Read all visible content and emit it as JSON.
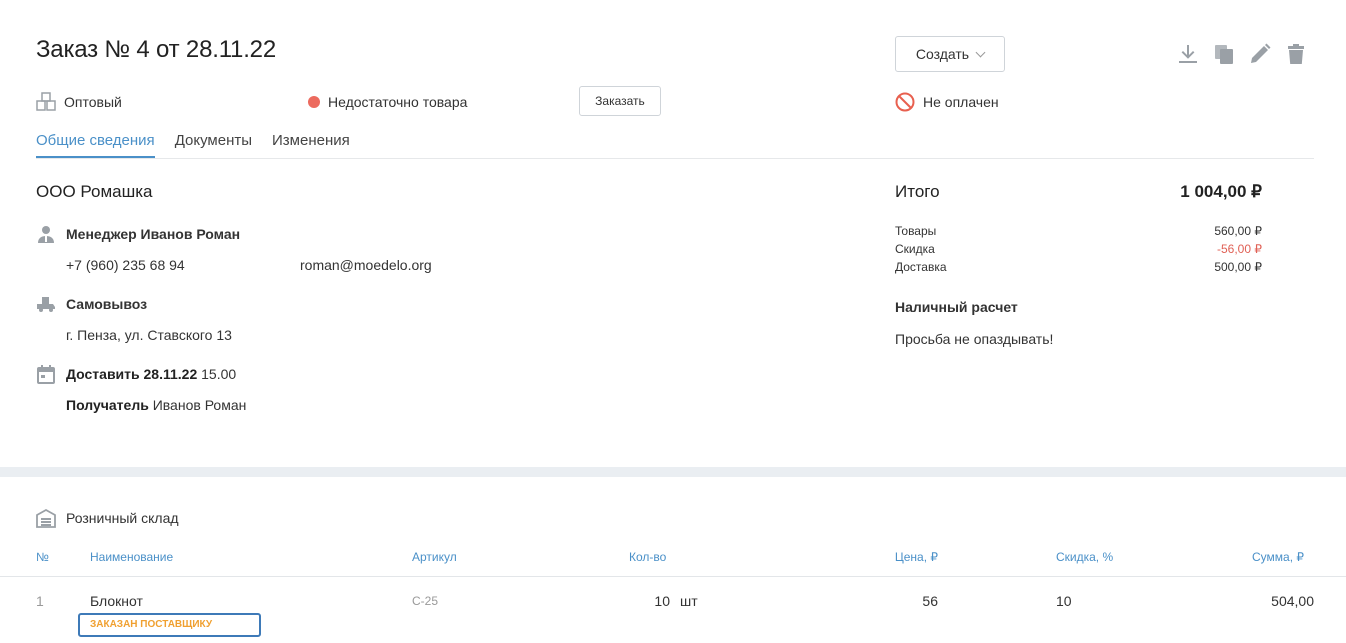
{
  "header": {
    "title": "Заказ № 4 от 28.11.22",
    "create_label": "Создать",
    "toolbar_icons": [
      "download-icon",
      "copy-icon",
      "edit-icon",
      "delete-icon"
    ]
  },
  "status": {
    "type_label": "Оптовый",
    "stock_label": "Недостаточно товара",
    "stock_color": "#ec6a5e",
    "order_button": "Заказать",
    "payment_label": "Не оплачен"
  },
  "tabs": [
    {
      "label": "Общие сведения",
      "active": true
    },
    {
      "label": "Документы",
      "active": false
    },
    {
      "label": "Изменения",
      "active": false
    }
  ],
  "client": {
    "company": "ООО Ромашка",
    "manager_label": "Менеджер Иванов Роман",
    "phone": "+7 (960) 235 68 94",
    "email": "roman@moedelo.org",
    "delivery_method": "Самовывоз",
    "address": "г. Пенза, ул. Ставского 13",
    "delivery_date_label": "Доставить 28.11.22",
    "delivery_time": "15.00",
    "recipient_label": "Получатель",
    "recipient_name": "Иванов Роман"
  },
  "summary": {
    "title": "Итого",
    "total": "1 004,00 ₽",
    "rows": [
      {
        "label": "Товары",
        "value": "560,00 ₽"
      },
      {
        "label": "Скидка",
        "value": "-56,00 ₽"
      },
      {
        "label": "Доставка",
        "value": "500,00 ₽"
      }
    ],
    "payment_method": "Наличный расчет",
    "comment": "Просьба не опаздывать!"
  },
  "warehouse": {
    "name": "Розничный склад"
  },
  "table": {
    "columns": [
      "№",
      "Наименование",
      "Артикул",
      "Кол-во",
      "Цена, ₽",
      "Скидка, %",
      "Сумма, ₽"
    ],
    "rows": [
      {
        "num": "1",
        "name": "Блокнот",
        "article": "С-25",
        "qty": "10",
        "unit": "шт",
        "price": "56",
        "discount": "10",
        "sum": "504,00",
        "badge": "ЗАКАЗАН ПОСТАВЩИКУ"
      }
    ]
  }
}
